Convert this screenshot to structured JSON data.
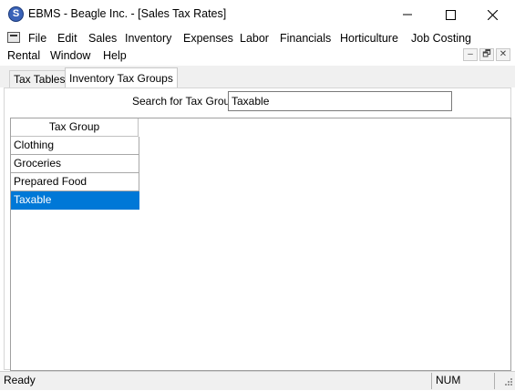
{
  "window": {
    "title": "EBMS - Beagle Inc. - [Sales Tax Rates]",
    "icon_letter": "S",
    "controls": {
      "minimize": "minimize-icon",
      "maximize": "maximize-icon",
      "close": "close-icon"
    }
  },
  "menu": {
    "row1": [
      "File",
      "Edit",
      "Sales",
      "Inventory",
      "Expenses",
      "Labor",
      "Financials",
      "Horticulture",
      "Job Costing"
    ],
    "row2": [
      "Rental",
      "Window",
      "Help"
    ],
    "mdi_controls": [
      "–",
      "🗗",
      "✕"
    ]
  },
  "tabs": [
    {
      "label": "Tax Tables",
      "active": false
    },
    {
      "label": "Inventory Tax Groups",
      "active": true
    }
  ],
  "search": {
    "label": "Search for Tax Group",
    "value": "Taxable"
  },
  "grid": {
    "columns": [
      "Tax Group"
    ],
    "rows": [
      "Clothing",
      "Groceries",
      "Prepared Food",
      "Taxable"
    ],
    "selected_index": 3
  },
  "status": {
    "left": "Ready",
    "num": "NUM"
  },
  "colors": {
    "selection": "#0078d7",
    "app_icon": "#3a63b8"
  }
}
